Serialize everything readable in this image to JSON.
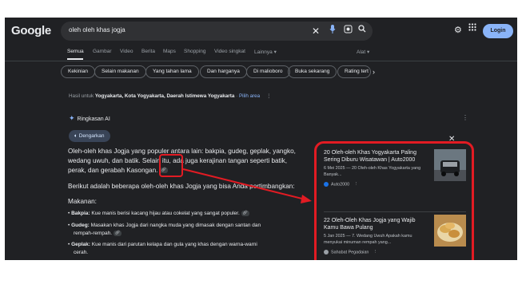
{
  "header": {
    "logo": "Google",
    "query": "oleh oleh khas jogja",
    "icons": [
      "close-icon",
      "mic-icon",
      "lens-icon",
      "search-icon"
    ],
    "settings_icon": "⚙",
    "apps_icon": "⋮⋮",
    "login_label": "Login"
  },
  "tabs": [
    "Semua",
    "Gambar",
    "Video",
    "Berita",
    "Maps",
    "Shopping",
    "Video singkat",
    "Lainnya ▾",
    "Alat ▾"
  ],
  "chips": [
    "Kekinian",
    "Selain makanan",
    "Yang tahan lama",
    "Dan harganya",
    "Di malioboro",
    "Buka sekarang",
    "Rating tert"
  ],
  "results_for": {
    "prefix": "Hasil untuk",
    "place": "Yogyakarta, Kota Yogyakarta, Daerah Istimewa Yogyakarta",
    "separator": "·",
    "link": "Pilih area"
  },
  "ai_overview": {
    "title": "Ringkasan AI",
    "listen_label": "Dengarkan",
    "para1_lines": [
      "Oleh-oleh khas Jogja yang populer antara lain: bakpia, gudeg, geplak, yangko,",
      "wedang uwuh, dan batik. Selain itu, ada juga kerajinan tangan seperti batik,",
      "perak, dan gerabah Kasongan."
    ],
    "para2": "Berikut adalah beberapa oleh-oleh khas Jogja yang bisa Anda pertimbangkan:",
    "section": "Makanan:",
    "bullets": [
      {
        "name": "Bakpia:",
        "text": " Kue manis berisi kacang hijau atau cokelat yang sangat populer."
      },
      {
        "name": "Gudeg:",
        "text": " Masakan khas Jogja dari nangka muda yang dimasak dengan santan dan"
      },
      {
        "name": "",
        "text": "rempah-rempah."
      },
      {
        "name": "Geplak:",
        "text": " Kue manis dari parutan kelapa dan gula yang khas dengan warna-warni"
      },
      {
        "name": "",
        "text": "cerah."
      }
    ]
  },
  "sources": [
    {
      "title": "20 Oleh-oleh Khas Yogyakarta Paling Sering Diburu Wisatawan | Auto2000",
      "snippet": "6 Mei 2025 — 20 Oleh-oleh Khas Yogyakarta yang Banyak...",
      "source": "Auto2000",
      "fav_color": "#1a73e8"
    },
    {
      "title": "22 Oleh-Oleh Khas Jogja yang Wajib Kamu Bawa Pulang",
      "snippet": "5 Jan 2025 — 7. Wedang Uwuh Apakah kamu menyukai minuman rempah yang...",
      "source": "Sahabat Pegadaian",
      "fav_color": "#9aa0a6"
    }
  ],
  "colors": {
    "background": "#202124",
    "highlight": "#e21b23",
    "accent": "#8ab4f8"
  }
}
